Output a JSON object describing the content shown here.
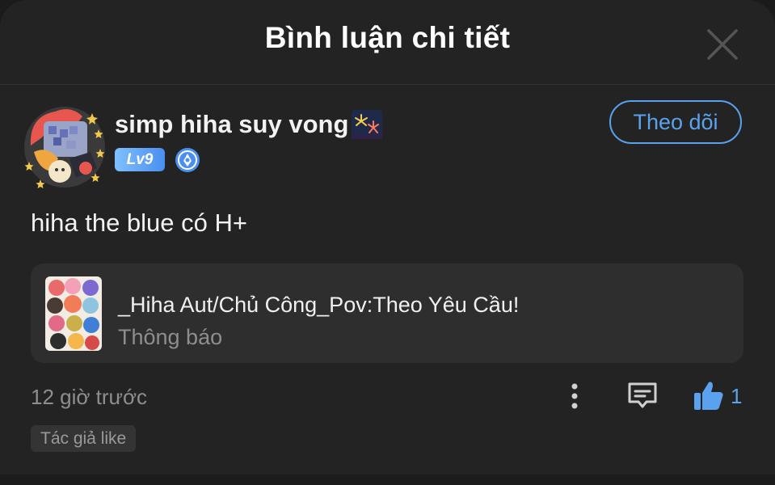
{
  "header": {
    "title": "Bình luận chi tiết",
    "close_icon": "close-icon"
  },
  "comment": {
    "username": "simp hiha suy vong",
    "username_emoji": "fireworks-icon",
    "level": "Lv9",
    "verified_icon": "verify-badge-icon",
    "follow_label": "Theo dõi",
    "text": "hiha the blue có H+"
  },
  "linked_post": {
    "title": "_Hiha Aut/Chủ Công_Pov:Theo Yêu Cầu!",
    "subtitle": "Thông báo"
  },
  "footer": {
    "time": "12 giờ trước",
    "like_count": "1",
    "author_like": "Tác giả like"
  },
  "colors": {
    "background": "#232323",
    "accent": "#5aa2ee",
    "card": "#2e2e2e",
    "muted_text": "#8e8e8e"
  }
}
